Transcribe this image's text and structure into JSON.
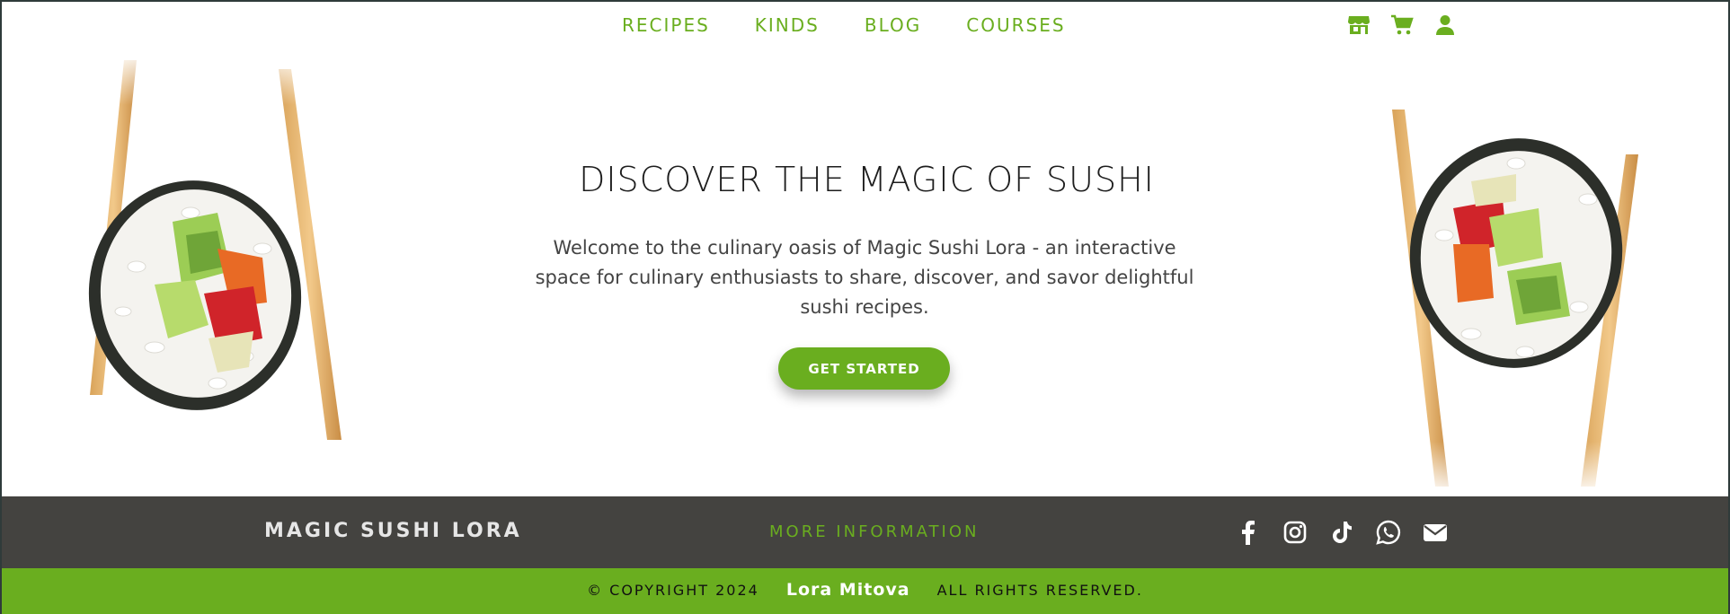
{
  "nav": {
    "links": [
      "RECIPES",
      "KINDS",
      "BLOG",
      "COURSES"
    ],
    "icons": [
      "store-icon",
      "cart-icon",
      "user-icon"
    ]
  },
  "hero": {
    "title": "DISCOVER THE MAGIC OF SUSHI",
    "text": "Welcome to the culinary oasis of Magic Sushi Lora - an interactive space for culinary enthusiasts to share, discover, and savor delightful sushi recipes.",
    "cta_label": "GET STARTED"
  },
  "footer": {
    "brand": "MAGIC SUSHI LORA",
    "more_info": "MORE INFORMATION",
    "socials": [
      "facebook-icon",
      "instagram-icon",
      "tiktok-icon",
      "whatsapp-icon",
      "email-icon"
    ],
    "copyright": "© COPYRIGHT 2024",
    "author": "Lora Mitova",
    "rights": "ALL RIGHTS RESERVED."
  },
  "colors": {
    "accent": "#6aae1f",
    "footer_dark": "#444340"
  }
}
